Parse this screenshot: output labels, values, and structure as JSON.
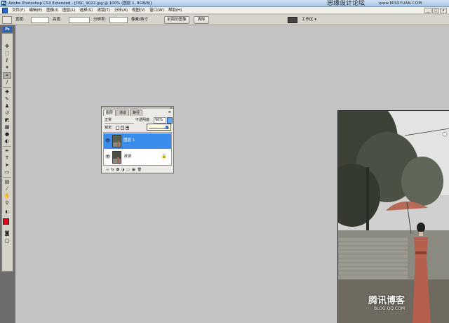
{
  "window": {
    "title": "Adobe Photoshop CS3 Extended - [DSC_9022.jpg @ 100% (图层 1, RGB/8)]",
    "brand": "思缘设计论坛",
    "site": "www.MISSYUAN.COM"
  },
  "menu": [
    "文件(F)",
    "编辑(E)",
    "图像(I)",
    "图层(L)",
    "选择(S)",
    "滤镜(T)",
    "分析(A)",
    "视图(V)",
    "窗口(W)",
    "帮助(H)"
  ],
  "window_controls": [
    "_",
    "□",
    "x"
  ],
  "options": {
    "width_label": "宽度:",
    "height_label": "高度:",
    "resolution_label": "分辨率:",
    "unit_dropdown": "像素/英寸",
    "front_image_button": "前面的图像",
    "clear_button": "清除",
    "workspace": "工作区 ▾"
  },
  "toolbox": {
    "badge": "Ps",
    "tools": [
      "move-tool",
      "marquee-tool",
      "lasso-tool",
      "magic-wand-tool",
      "crop-tool",
      "slice-tool",
      "healing-brush-tool",
      "brush-tool",
      "clone-stamp-tool",
      "history-brush-tool",
      "eraser-tool",
      "gradient-tool",
      "blur-tool",
      "dodge-tool",
      "pen-tool",
      "type-tool",
      "path-selection-tool",
      "shape-tool",
      "notes-tool",
      "eyedropper-tool",
      "hand-tool",
      "zoom-tool"
    ],
    "foreground_color": "#e8001c",
    "background_color": "#ffffff"
  },
  "layers_panel": {
    "tabs": [
      "图层",
      "通道",
      "路径"
    ],
    "active_tab": "图层",
    "blend_mode": "正常",
    "opacity_label": "不透明度:",
    "opacity_value": "90%",
    "lock_label": "锁定:",
    "layers": [
      {
        "name": "图层 1",
        "selected": true,
        "visible": true,
        "locked": false
      },
      {
        "name": "背景",
        "selected": false,
        "visible": true,
        "locked": true
      }
    ],
    "footer_icons": [
      "link-icon",
      "fx-icon",
      "mask-icon",
      "adjustment-icon",
      "group-icon",
      "new-layer-icon",
      "trash-icon"
    ]
  },
  "watermark": {
    "text": "腾讯博客",
    "url": "BLOG.QQ.COM"
  }
}
